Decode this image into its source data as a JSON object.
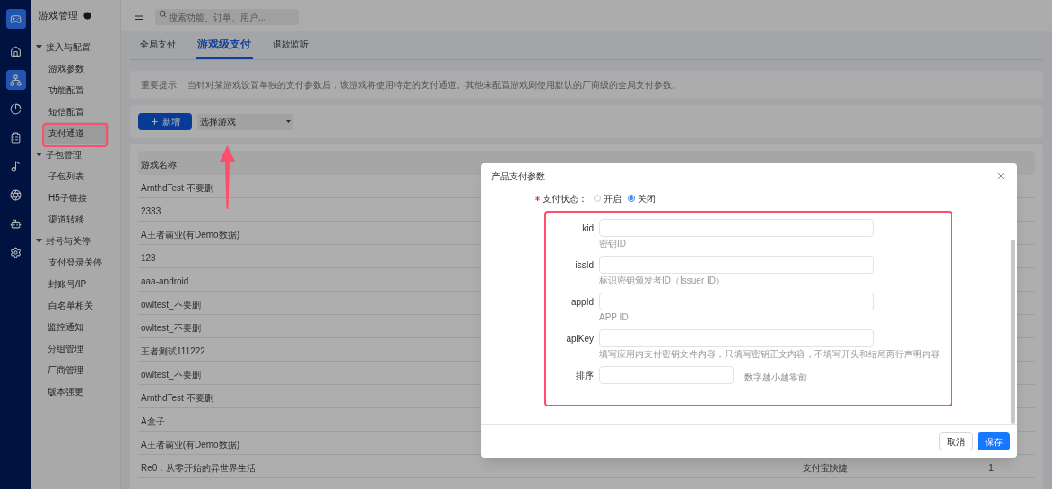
{
  "rail": [
    {
      "kind": "home",
      "selected": false
    },
    {
      "kind": "network",
      "selected": true
    },
    {
      "kind": "pie",
      "selected": false
    },
    {
      "kind": "clipboard",
      "selected": false
    },
    {
      "kind": "music",
      "selected": false
    },
    {
      "kind": "aperture",
      "selected": false
    },
    {
      "kind": "bot",
      "selected": false
    },
    {
      "kind": "settings",
      "selected": false
    }
  ],
  "sidebar": {
    "title": "游戏管理",
    "items": [
      {
        "kind": "group",
        "label": "接入与配置",
        "expanded": true,
        "children": [
          {
            "label": "游戏参数",
            "selected": false
          },
          {
            "label": "功能配置",
            "selected": false
          },
          {
            "label": "短信配置",
            "selected": false
          },
          {
            "label": "支付通道",
            "selected": true
          }
        ]
      },
      {
        "kind": "group",
        "label": "子包管理",
        "expanded": true,
        "children": [
          {
            "label": "子包列表",
            "selected": false
          },
          {
            "label": "H5子链接",
            "selected": false
          },
          {
            "label": "渠道转移",
            "selected": false
          }
        ]
      },
      {
        "kind": "group",
        "label": "封号与关停",
        "expanded": true,
        "children": [
          {
            "label": "支付登录关停",
            "selected": false
          },
          {
            "label": "封账号/IP",
            "selected": false
          },
          {
            "label": "白名单相关",
            "selected": false
          }
        ]
      },
      {
        "kind": "link",
        "label": "监控通知",
        "selected": false
      },
      {
        "kind": "link",
        "label": "分组管理",
        "selected": false
      },
      {
        "kind": "link",
        "label": "厂商管理",
        "selected": false
      },
      {
        "kind": "link",
        "label": "版本强更",
        "selected": false
      }
    ]
  },
  "search": {
    "placeholder": "搜索功能、订单、用户..."
  },
  "tabs": [
    {
      "label": "全局支付",
      "selected": false
    },
    {
      "label": "游戏级支付",
      "selected": true
    },
    {
      "label": "退款监听",
      "selected": false
    }
  ],
  "notice": {
    "title": "重要提示",
    "text": "当针对某游戏设置单独的支付参数后，该游戏将使用特定的支付通道。其他未配置游戏则使用默认的厂商级的全局支付参数。"
  },
  "toolbar": {
    "add_button": "新增",
    "game_select": {
      "placeholder": "选择游戏"
    }
  },
  "table": {
    "columns": [
      "游戏名称"
    ],
    "rows": [
      {
        "cells": [
          "ArnthdTest 不要删"
        ]
      },
      {
        "cells": [
          "2333"
        ]
      },
      {
        "cells": [
          "A王者霸业(有Demo数据)"
        ]
      },
      {
        "cells": [
          "123"
        ]
      },
      {
        "cells": [
          "aaa-android"
        ]
      },
      {
        "cells": [
          "owltest_不要删"
        ]
      },
      {
        "cells": [
          "owltest_不要删"
        ]
      },
      {
        "cells": [
          "王者测试111222"
        ]
      },
      {
        "cells": [
          "owltest_不要删"
        ]
      },
      {
        "cells": [
          "ArnthdTest 不要删"
        ]
      },
      {
        "cells": [
          "A盒子"
        ]
      },
      {
        "cells": [
          "A王者霸业(有Demo数据)"
        ]
      },
      {
        "cells": [
          "Re0：从零开始的异世界生活",
          "支付宝快捷",
          "1"
        ]
      }
    ]
  },
  "dialog": {
    "title": "产品支付参数",
    "status": {
      "label": "支付状态：",
      "required": true,
      "options": [
        {
          "label": "开启",
          "selected": false
        },
        {
          "label": "关闭",
          "selected": true
        }
      ]
    },
    "fields": [
      {
        "kind": "wide",
        "label": "kid",
        "help": "密钥ID"
      },
      {
        "kind": "wide",
        "label": "issId",
        "help": "标识密钥颁发者ID（Issuer ID）"
      },
      {
        "kind": "wide",
        "label": "appId",
        "help": "APP ID"
      },
      {
        "kind": "wide",
        "label": "apiKey",
        "help": "填写应用内支付密钥文件内容，只填写密钥正文内容，不填写开头和结尾两行声明内容"
      },
      {
        "kind": "short",
        "label": "排序",
        "note": "数字越小越靠前"
      }
    ],
    "buttons": [
      {
        "kind": "default",
        "label": "取消"
      },
      {
        "kind": "primary",
        "label": "保存"
      }
    ]
  }
}
